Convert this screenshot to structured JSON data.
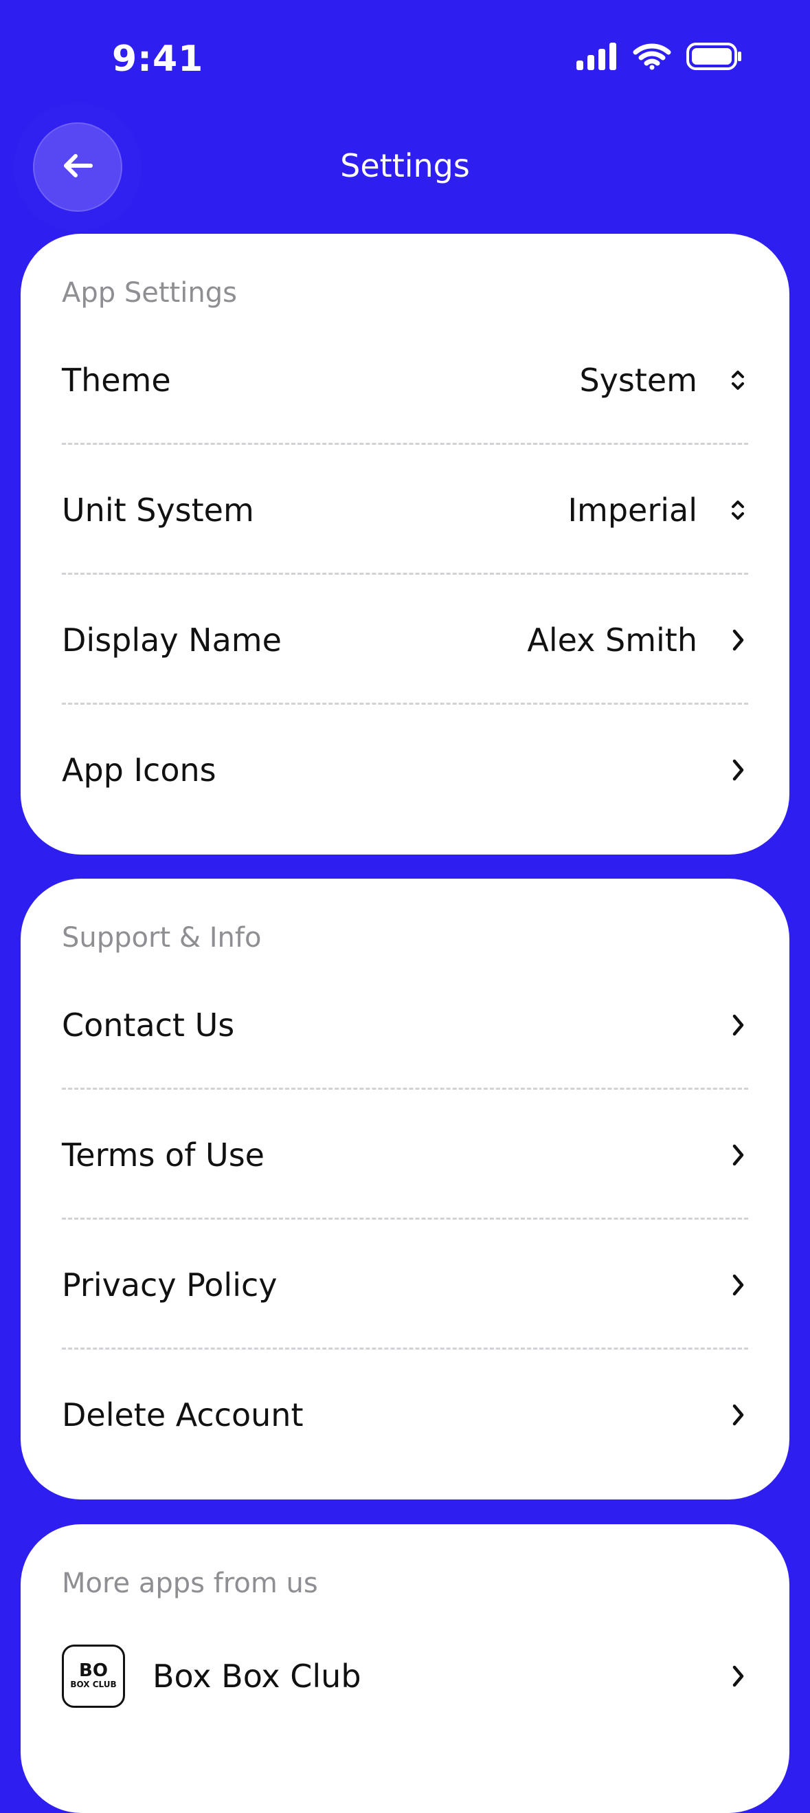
{
  "status_bar": {
    "time": "9:41"
  },
  "header": {
    "title": "Settings"
  },
  "sections": [
    {
      "title": "App Settings",
      "items": [
        {
          "label": "Theme",
          "value": "System",
          "control": "select"
        },
        {
          "label": "Unit System",
          "value": "Imperial",
          "control": "select"
        },
        {
          "label": "Display Name",
          "value": "Alex Smith",
          "control": "chevron"
        },
        {
          "label": "App Icons",
          "value": "",
          "control": "chevron"
        }
      ]
    },
    {
      "title": "Support & Info",
      "items": [
        {
          "label": "Contact Us",
          "value": "",
          "control": "chevron"
        },
        {
          "label": "Terms of Use",
          "value": "",
          "control": "chevron"
        },
        {
          "label": "Privacy Policy",
          "value": "",
          "control": "chevron"
        },
        {
          "label": "Delete Account",
          "value": "",
          "control": "chevron"
        }
      ]
    },
    {
      "title": "More apps from us",
      "items": [
        {
          "label": "Box Box Club",
          "value": "",
          "control": "chevron",
          "app_badge": "BOX BOX CLUB"
        }
      ]
    }
  ],
  "colors": {
    "accent": "#2e1ff0",
    "card": "#ffffff",
    "muted_text": "#8e8e93"
  },
  "icons": {
    "back": "back-arrow-icon",
    "select": "updown-chevron-icon",
    "chevron": "chevron-right-icon",
    "signal": "signal-icon",
    "wifi": "wifi-icon",
    "battery": "battery-icon",
    "app": "box-box-club-icon"
  }
}
